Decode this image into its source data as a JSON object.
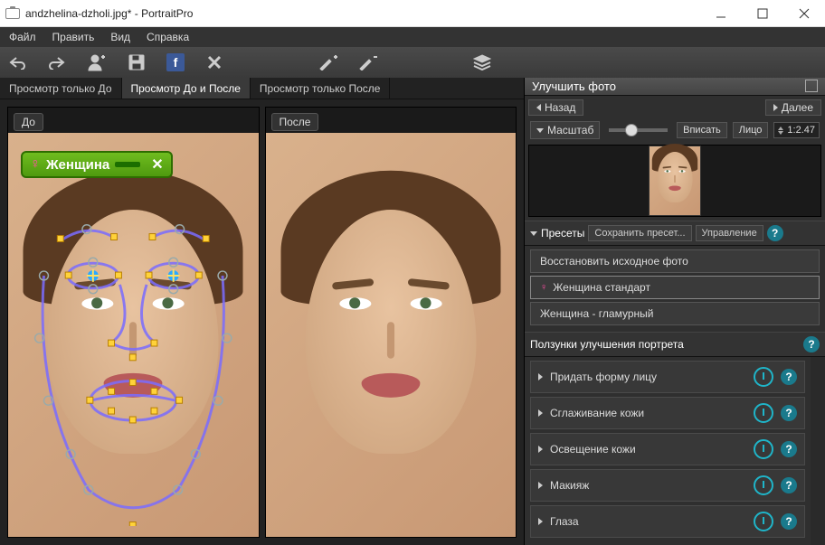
{
  "window": {
    "title": "andzhelina-dzholi.jpg* - PortraitPro"
  },
  "menu": {
    "file": "Файл",
    "edit": "Править",
    "view": "Вид",
    "help": "Справка"
  },
  "tabs": {
    "before": "Просмотр только До",
    "both": "Просмотр До и После",
    "after": "Просмотр только После"
  },
  "panels": {
    "before": "До",
    "after": "После"
  },
  "gender": {
    "label": "Женщина",
    "symbol": "♀"
  },
  "right": {
    "title": "Улучшить фото",
    "back": "Назад",
    "next": "Далее",
    "scale": "Масштаб",
    "fit": "Вписать",
    "face": "Лицо",
    "ratio": "1:2.47",
    "presets": "Пресеты",
    "savePreset": "Сохранить пресет...",
    "manage": "Управление",
    "presetItems": {
      "restore": "Восстановить исходное фото",
      "std": "Женщина стандарт",
      "glam": "Женщина - гламурный"
    },
    "slidersTitle": "Ползунки улучшения портрета",
    "sliders": {
      "shape": "Придать форму лицу",
      "skin": "Сглаживание кожи",
      "light": "Освещение кожи",
      "makeup": "Макияж",
      "eyes": "Глаза"
    }
  }
}
